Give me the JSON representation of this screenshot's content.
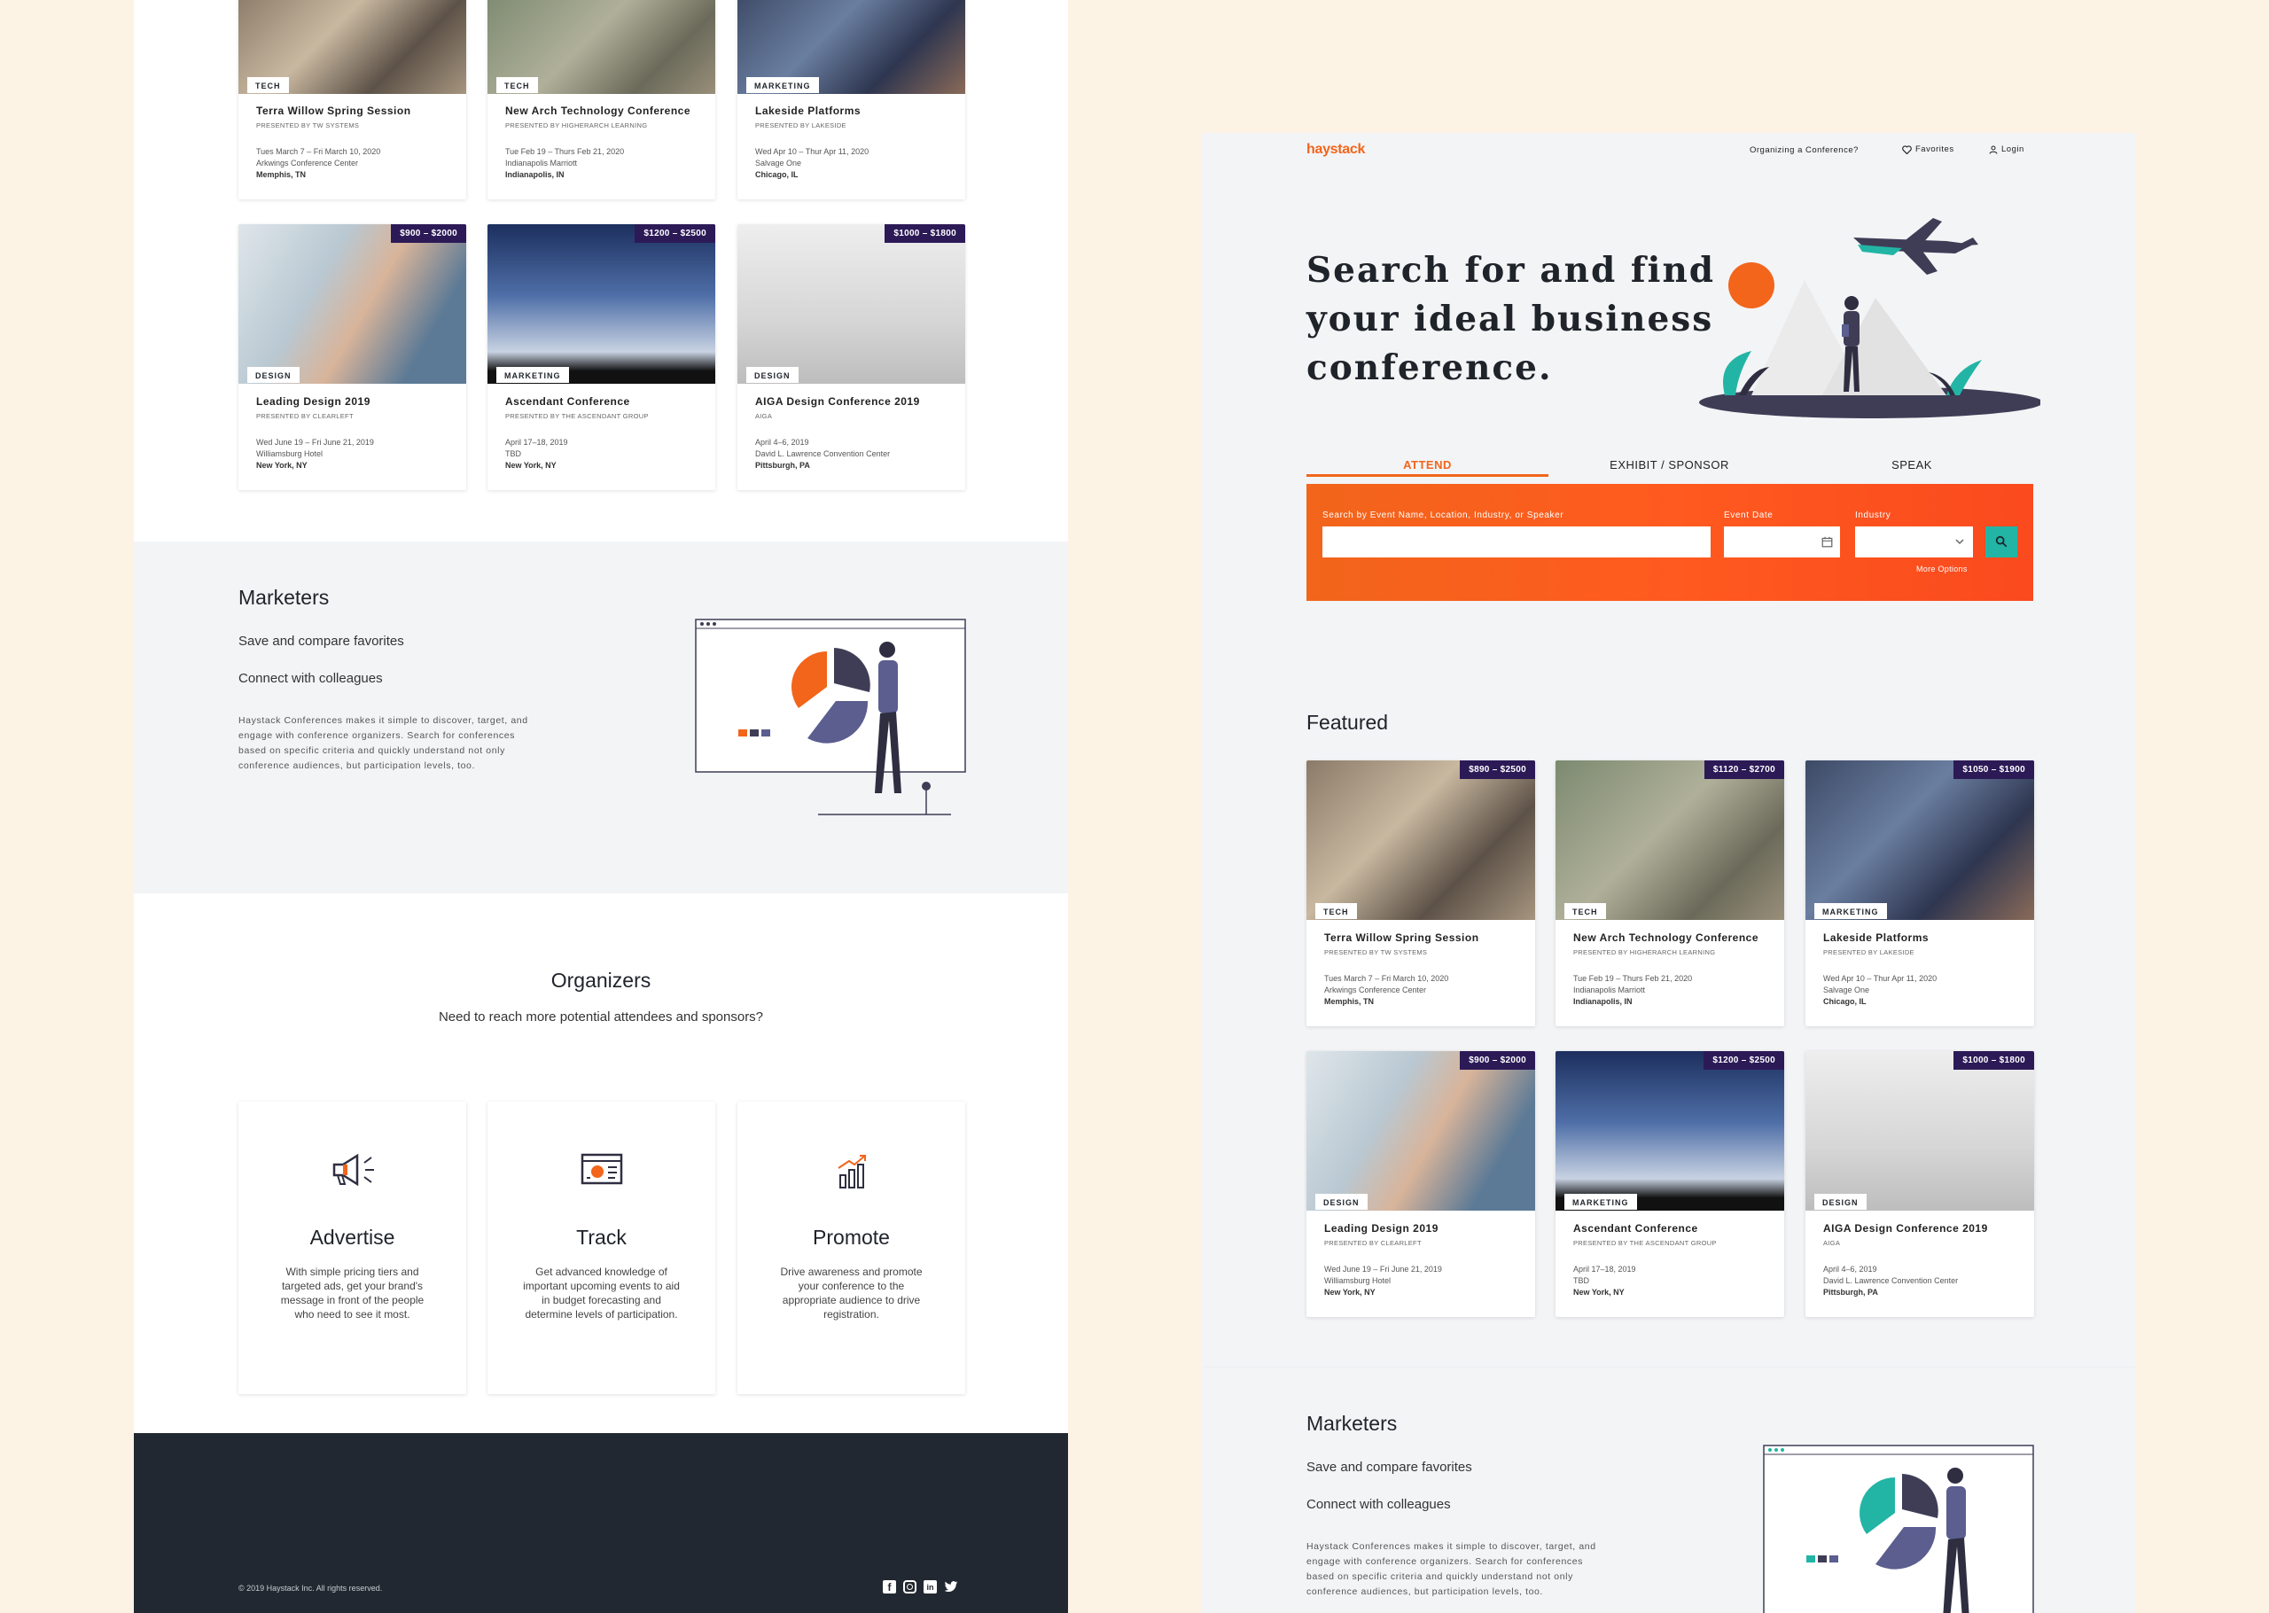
{
  "brand": {
    "logo": "haystack",
    "accent": "#f2651b",
    "purple": "#2c1a57",
    "dark": "#222831",
    "teal": "#22b5a5"
  },
  "nav": {
    "organizing": "Organizing a Conference?",
    "favorites": "Favorites",
    "login": "Login"
  },
  "hero": {
    "title_line1": "Search for and find",
    "title_line2": "your ideal business",
    "title_line3": "conference."
  },
  "tabs": [
    {
      "label": "ATTEND",
      "active": true
    },
    {
      "label": "EXHIBIT / SPONSOR",
      "active": false
    },
    {
      "label": "SPEAK",
      "active": false
    }
  ],
  "search": {
    "event_label": "Search by Event Name, Location, Industry, or Speaker",
    "date_label": "Event Date",
    "industry_label": "Industry",
    "more_options": "More Options",
    "event_value": "",
    "date_value": "",
    "industry_value": ""
  },
  "featured": {
    "heading": "Featured"
  },
  "conferences": [
    {
      "price": "$890 – $2500",
      "tag": "TECH",
      "title": "Terra Willow Spring Session",
      "presenter": "PRESENTED BY TW SYSTEMS",
      "dates": "Tues March 7 – Fri March 10, 2020",
      "venue": "Arkwings Conference Center",
      "city": "Memphis, TN"
    },
    {
      "price": "$1120 – $2700",
      "tag": "TECH",
      "title": "New Arch Technology Conference",
      "presenter": "PRESENTED BY HIGHERARCH LEARNING",
      "dates": "Tue Feb 19 – Thurs Feb 21, 2020",
      "venue": "Indianapolis Marriott",
      "city": "Indianapolis, IN"
    },
    {
      "price": "$1050 – $1900",
      "tag": "MARKETING",
      "title": "Lakeside Platforms",
      "presenter": "PRESENTED BY LAKESIDE",
      "dates": "Wed Apr 10 – Thur Apr 11, 2020",
      "venue": "Salvage One",
      "city": "Chicago, IL"
    },
    {
      "price": "$900 – $2000",
      "tag": "DESIGN",
      "title": "Leading Design 2019",
      "presenter": "PRESENTED BY CLEARLEFT",
      "dates": "Wed June 19 – Fri June 21, 2019",
      "venue": "Williamsburg Hotel",
      "city": "New York, NY"
    },
    {
      "price": "$1200 – $2500",
      "tag": "MARKETING",
      "title": "Ascendant Conference",
      "presenter": "PRESENTED BY THE ASCENDANT GROUP",
      "dates": "April 17–18, 2019",
      "venue": "TBD",
      "city": "New York, NY"
    },
    {
      "price": "$1000 – $1800",
      "tag": "DESIGN",
      "title": "AIGA Design Conference 2019",
      "presenter": "AIGA",
      "dates": "April 4–6, 2019",
      "venue": "David L. Lawrence Convention Center",
      "city": "Pittsburgh, PA"
    }
  ],
  "marketers": {
    "heading": "Marketers",
    "item1": "Save and compare favorites",
    "item2": "Connect with colleagues",
    "body1": "Haystack Conferences makes it simple to discover, target, and",
    "body2": "engage with conference organizers. Search for conferences",
    "body3": "based on specific criteria and quickly understand not only",
    "body4": "conference audiences, but participation levels, too."
  },
  "organizers": {
    "heading": "Organizers",
    "subheading": "Need to reach more potential attendees and sponsors?",
    "features": [
      {
        "icon": "megaphone-icon",
        "title": "Advertise",
        "l1": "With simple pricing tiers and",
        "l2": "targeted ads, get your brand's",
        "l3": "message in front of the people",
        "l4": "who need to see it most."
      },
      {
        "icon": "dashboard-icon",
        "title": "Track",
        "l1": "Get advanced knowledge of",
        "l2": "important upcoming events to aid",
        "l3": "in budget forecasting and",
        "l4": "determine levels of participation."
      },
      {
        "icon": "growth-chart-icon",
        "title": "Promote",
        "l1": "Drive awareness and promote",
        "l2": "your conference to the",
        "l3": "appropriate audience to drive",
        "l4": "registration."
      }
    ]
  },
  "footer": {
    "copyright": "© 2019 Haystack Inc. All rights reserved.",
    "social": [
      "facebook-icon",
      "instagram-icon",
      "linkedin-icon",
      "twitter-icon"
    ]
  }
}
